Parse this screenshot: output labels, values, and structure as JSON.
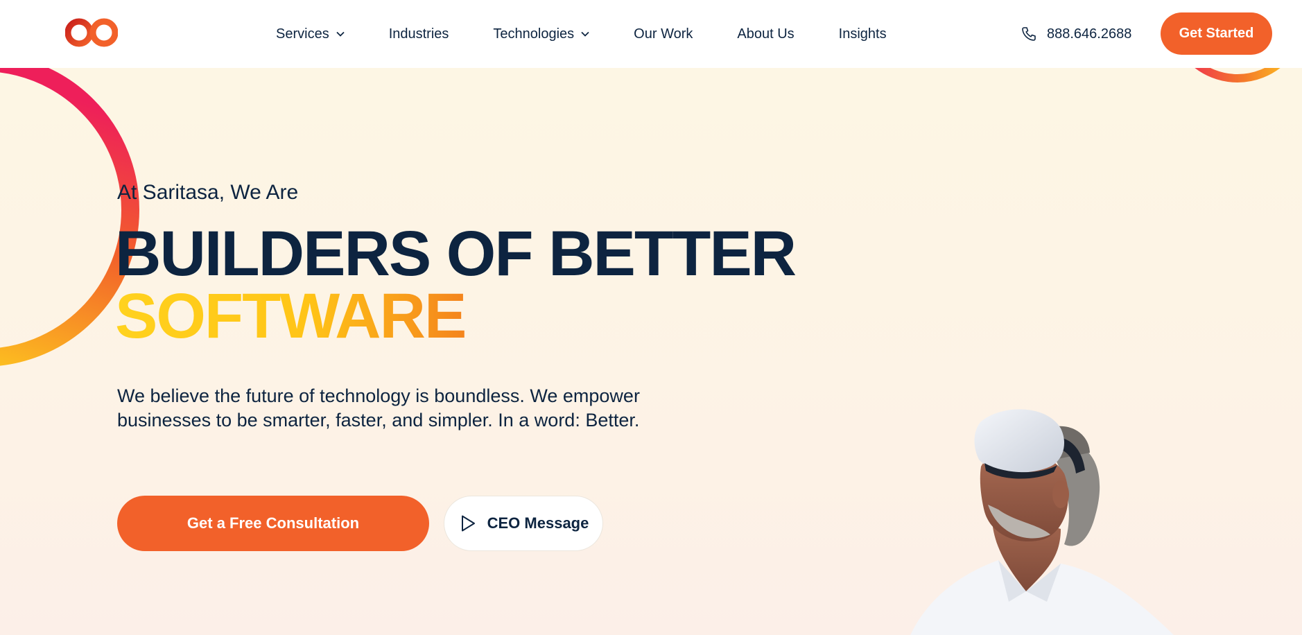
{
  "header": {
    "logo": "saritasa-logo",
    "nav": [
      {
        "label": "Services",
        "has_dropdown": true
      },
      {
        "label": "Industries",
        "has_dropdown": false
      },
      {
        "label": "Technologies",
        "has_dropdown": true
      },
      {
        "label": "Our Work",
        "has_dropdown": false
      },
      {
        "label": "About Us",
        "has_dropdown": false
      },
      {
        "label": "Insights",
        "has_dropdown": false
      }
    ],
    "phone": "888.646.2688",
    "cta_label": "Get Started"
  },
  "hero": {
    "eyebrow": "At Saritasa, We Are",
    "headline_line1": "BUILDERS OF BETTER",
    "headline_line2": "SOFTWARE",
    "lede": "We believe the future of technology is boundless. We empower businesses to be smarter, faster, and simpler. In a word: Better.",
    "primary_cta": "Get a Free Consultation",
    "secondary_cta": "CEO Message",
    "image_subject": "man wearing VR headset"
  },
  "colors": {
    "accent": "#f2612a",
    "navy": "#0d2440",
    "yellow": "#ffd21e",
    "pink": "#ee2061",
    "hero_bg": "#fdf6e4"
  }
}
